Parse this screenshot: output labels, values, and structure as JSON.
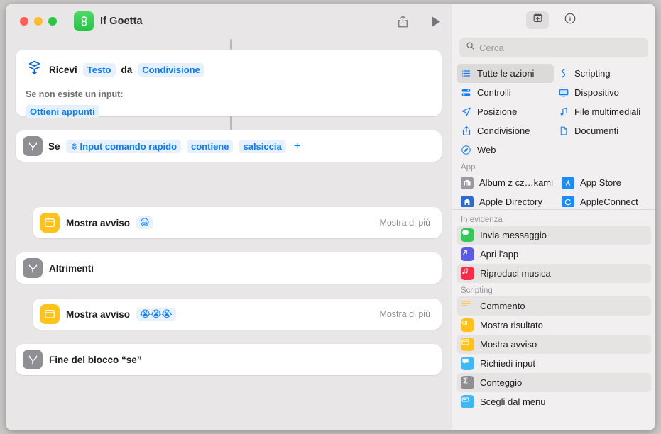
{
  "window": {
    "title": "If Goetta",
    "app_icon": "shortcuts-icon",
    "traffic_lights": [
      "close",
      "minimize",
      "zoom"
    ],
    "toolbar": {
      "share_label": "share-icon",
      "run_label": "play-icon"
    }
  },
  "workflow": {
    "receive": {
      "icon": "receive-input-icon",
      "prefix": "Ricevi",
      "type_token": "Testo",
      "middle": "da",
      "source_token": "Condivisione",
      "fallback_label": "Se non esiste un input:",
      "fallback_token": "Ottieni appunti"
    },
    "if": {
      "icon": "if-branch-icon",
      "prefix": "Se",
      "variable_token": "Input comando rapido",
      "operator_token": "contiene",
      "value_token": "salsiccia",
      "add_label": "+"
    },
    "then_action": {
      "icon": "show-alert-icon",
      "label": "Mostra avviso",
      "emoji_token": "😀",
      "more_label": "Mostra di più"
    },
    "otherwise": {
      "icon": "if-branch-icon",
      "label": "Altrimenti"
    },
    "else_action": {
      "icon": "show-alert-icon",
      "label": "Mostra avviso",
      "emoji_token": "😭😭😭",
      "more_label": "Mostra di più"
    },
    "end_if": {
      "icon": "if-branch-icon",
      "label": "Fine del blocco “se”"
    }
  },
  "sidebar": {
    "toolbar": {
      "add_action_label": "add-action-icon",
      "info_label": "info-icon"
    },
    "search": {
      "placeholder": "Cerca",
      "value": ""
    },
    "categories": [
      {
        "label": "Tutte le azioni",
        "icon": "list-icon",
        "selected": true
      },
      {
        "label": "Scripting",
        "icon": "scripting-icon",
        "selected": false
      },
      {
        "label": "Controlli",
        "icon": "controls-icon",
        "selected": false
      },
      {
        "label": "Dispositivo",
        "icon": "device-icon",
        "selected": false
      },
      {
        "label": "Posizione",
        "icon": "location-icon",
        "selected": false
      },
      {
        "label": "File multimediali",
        "icon": "media-icon",
        "selected": false
      },
      {
        "label": "Condivisione",
        "icon": "share-icon",
        "selected": false
      },
      {
        "label": "Documenti",
        "icon": "documents-icon",
        "selected": false
      },
      {
        "label": "Web",
        "icon": "web-icon",
        "selected": false
      }
    ],
    "sections": [
      {
        "title": "App",
        "layout": "grid",
        "items": [
          {
            "label": "Album z cz…kami",
            "icon": "album-icon",
            "color": "#9a9aa0"
          },
          {
            "label": "App Store",
            "icon": "appstore-icon",
            "color": "#1a8cff"
          },
          {
            "label": "Apple Directory",
            "icon": "apple-directory-icon",
            "color": "#2a6bd6"
          },
          {
            "label": "AppleConnect",
            "icon": "appleconnect-icon",
            "color": "#1a8cff"
          }
        ]
      },
      {
        "title": "In evidenza",
        "layout": "list",
        "items": [
          {
            "label": "Invia messaggio",
            "icon": "messages-icon",
            "color": "#34c759"
          },
          {
            "label": "Apri l’app",
            "icon": "open-app-icon",
            "color": "#5b5be5"
          },
          {
            "label": "Riproduci musica",
            "icon": "music-icon",
            "color": "#fa2d48"
          }
        ]
      },
      {
        "title": "Scripting",
        "layout": "list",
        "items": [
          {
            "label": "Commento",
            "icon": "comment-icon",
            "color": "#ffc21b"
          },
          {
            "label": "Mostra risultato",
            "icon": "show-result-icon",
            "color": "#ffc21b"
          },
          {
            "label": "Mostra avviso",
            "icon": "show-alert-icon",
            "color": "#ffc21b"
          },
          {
            "label": "Richiedi input",
            "icon": "ask-input-icon",
            "color": "#3fb8f5"
          },
          {
            "label": "Conteggio",
            "icon": "count-icon",
            "color": "#8e8e93"
          },
          {
            "label": "Scegli dal menu",
            "icon": "choose-menu-icon",
            "color": "#3fb8f5"
          }
        ]
      }
    ]
  },
  "colors": {
    "accent_blue": "#0a7cff",
    "token_bg": "#e6f0ff",
    "alert_yellow": "#ffc21b",
    "gray_icon": "#8e8e93",
    "window_bg": "#e8e6e6",
    "sidebar_bg": "#f1efef"
  }
}
